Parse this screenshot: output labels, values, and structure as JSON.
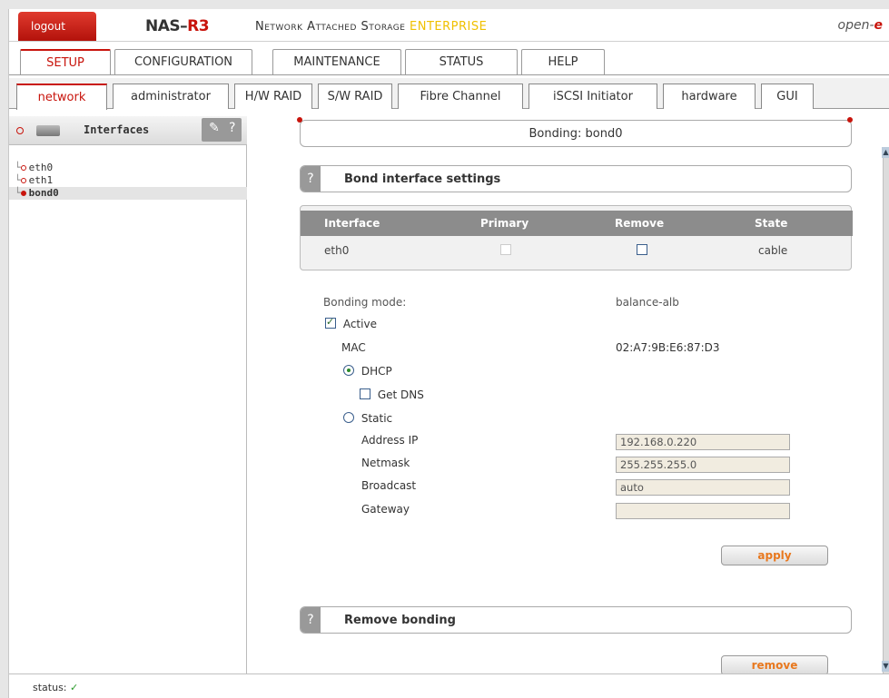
{
  "header": {
    "logout_label": "logout",
    "brand_prefix": "NAS–",
    "brand_suffix": "R3",
    "tagline": "Network Attached Storage",
    "tagline_edition": "ENTERPRISE",
    "vendor_prefix": "open-",
    "vendor_suffix": "e"
  },
  "main_tabs": [
    {
      "label": "SETUP",
      "active": true
    },
    {
      "label": "CONFIGURATION"
    },
    {
      "label": "MAINTENANCE"
    },
    {
      "label": "STATUS"
    },
    {
      "label": "HELP"
    }
  ],
  "sub_tabs": [
    {
      "label": "network",
      "active": true
    },
    {
      "label": "administrator"
    },
    {
      "label": "H/W RAID"
    },
    {
      "label": "S/W RAID"
    },
    {
      "label": "Fibre Channel"
    },
    {
      "label": "iSCSI Initiator"
    },
    {
      "label": "hardware"
    },
    {
      "label": "GUI"
    }
  ],
  "left_panel": {
    "title": "Interfaces",
    "help": "?",
    "items": [
      {
        "label": "eth0",
        "selected": false
      },
      {
        "label": "eth1",
        "selected": false
      },
      {
        "label": "bond0",
        "selected": true
      }
    ]
  },
  "content": {
    "title": "Bonding: bond0",
    "bond_section": {
      "help": "?",
      "title": "Bond interface settings"
    },
    "table": {
      "headers": [
        "Interface",
        "Primary",
        "Remove",
        "State"
      ],
      "rows": [
        {
          "interface": "eth0",
          "primary": false,
          "remove": false,
          "state": "cable"
        }
      ]
    },
    "form": {
      "bonding_mode_label": "Bonding mode:",
      "bonding_mode_value": "balance-alb",
      "active_label": "Active",
      "active_checked": true,
      "mac_label": "MAC",
      "mac_value": "02:A7:9B:E6:87:D3",
      "dhcp_label": "DHCP",
      "get_dns_label": "Get DNS",
      "static_label": "Static",
      "address_ip_label": "Address IP",
      "address_ip_value": "192.168.0.220",
      "netmask_label": "Netmask",
      "netmask_value": "255.255.255.0",
      "broadcast_label": "Broadcast",
      "broadcast_value": "auto",
      "gateway_label": "Gateway",
      "gateway_value": "",
      "apply_label": "apply"
    },
    "remove_section": {
      "help": "?",
      "title": "Remove bonding",
      "remove_label": "remove"
    }
  },
  "status": {
    "label": "status:",
    "icon": "check-icon",
    "glyph": "✓"
  }
}
